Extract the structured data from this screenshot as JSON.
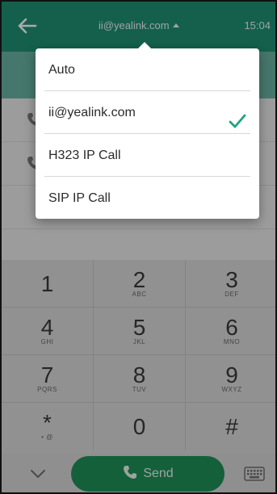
{
  "header": {
    "back_label": "back",
    "account": "ii@yealink.com",
    "time": "15:04"
  },
  "menu": {
    "items": [
      {
        "label": "Auto",
        "selected": false
      },
      {
        "label": "ii@yealink.com",
        "selected": true
      },
      {
        "label": "H323 IP Call",
        "selected": false
      },
      {
        "label": "SIP IP Call",
        "selected": false
      }
    ]
  },
  "dialpad": {
    "keys": [
      {
        "digit": "1",
        "letters": ""
      },
      {
        "digit": "2",
        "letters": "ABC"
      },
      {
        "digit": "3",
        "letters": "DEF"
      },
      {
        "digit": "4",
        "letters": "GHI"
      },
      {
        "digit": "5",
        "letters": "JKL"
      },
      {
        "digit": "6",
        "letters": "MNO"
      },
      {
        "digit": "7",
        "letters": "PQRS"
      },
      {
        "digit": "8",
        "letters": "TUV"
      },
      {
        "digit": "9",
        "letters": "WXYZ"
      },
      {
        "digit": "*",
        "letters": "• @"
      },
      {
        "digit": "0",
        "letters": ""
      },
      {
        "digit": "#",
        "letters": ""
      }
    ]
  },
  "bottom": {
    "send_label": "Send"
  },
  "colors": {
    "accent": "#1f8f74",
    "send": "#1f8f58",
    "check": "#1fa37f"
  }
}
